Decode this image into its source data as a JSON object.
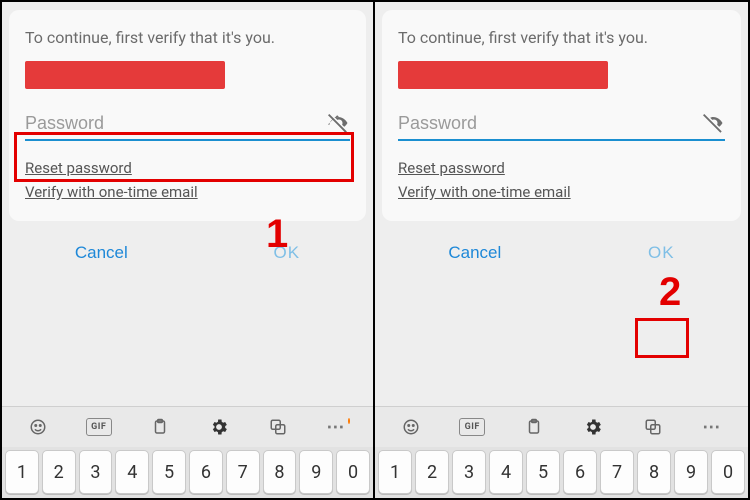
{
  "prompt_text": "To continue, first verify that it's you.",
  "password_placeholder": "Password",
  "link_reset": "Reset password",
  "link_otp": "Verify with one-time email",
  "btn_cancel": "Cancel",
  "btn_ok": "OK",
  "gif_label": "GIF",
  "annotation": {
    "step1": "1",
    "step2": "2"
  },
  "keys": [
    "1",
    "2",
    "3",
    "4",
    "5",
    "6",
    "7",
    "8",
    "9",
    "0"
  ]
}
